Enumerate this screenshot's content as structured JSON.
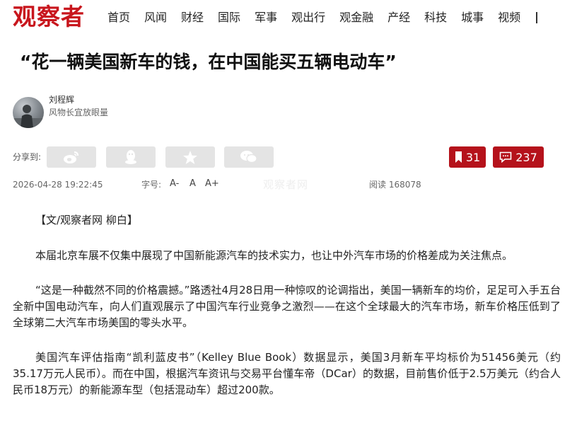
{
  "site": {
    "logo": "观察者"
  },
  "nav": {
    "items": [
      "首页",
      "风闻",
      "财经",
      "国际",
      "军事",
      "观出行",
      "观金融",
      "产经",
      "科技",
      "城事",
      "视频"
    ]
  },
  "article": {
    "title": "“花一辆美国新车的钱，在中国能买五辆电动车”",
    "author": {
      "name": "刘程辉",
      "title": "风物长宜放眼量"
    },
    "share_label": "分享到:",
    "share_icons": [
      "weibo-icon",
      "qq-icon",
      "qzone-star-icon",
      "wechat-icon"
    ],
    "favorites_count": "31",
    "comments_count": "237",
    "date": "2026-04-28 19:22:45",
    "font_size_label": "字号:",
    "font_smaller": "A-",
    "font_normal": "A",
    "font_larger": "A+",
    "watermark": "观察者网",
    "reads": "阅读 168078",
    "paragraphs": [
      "【文/观察者网 柳白】",
      "本届北京车展不仅集中展现了中国新能源汽车的技术实力，也让中外汽车市场的价格差成为关注焦点。",
      "“这是一种截然不同的价格震撼。”路透社4月28日用一种惊叹的论调指出，美国一辆新车的均价，足足可入手五台全新中国电动汽车，向人们直观展示了中国汽车行业竞争之激烈——在这个全球最大的汽车市场，新车价格压低到了全球第二大汽车市场美国的零头水平。",
      "美国汽车评估指南“凯利蓝皮书”（Kelley Blue Book）数据显示，美国3月新车平均标价为51456美元（约35.17万元人民币）。而在中国，根据汽车资讯与交易平台懂车帝（DCar）的数据，目前售价低于2.5万美元（约合人民币18万元）的新能源车型（包括混动车）超过200款。"
    ]
  },
  "colors": {
    "brand_red": "#c8161d",
    "button_red": "#b5121b",
    "share_gray": "#e4e4e4"
  }
}
